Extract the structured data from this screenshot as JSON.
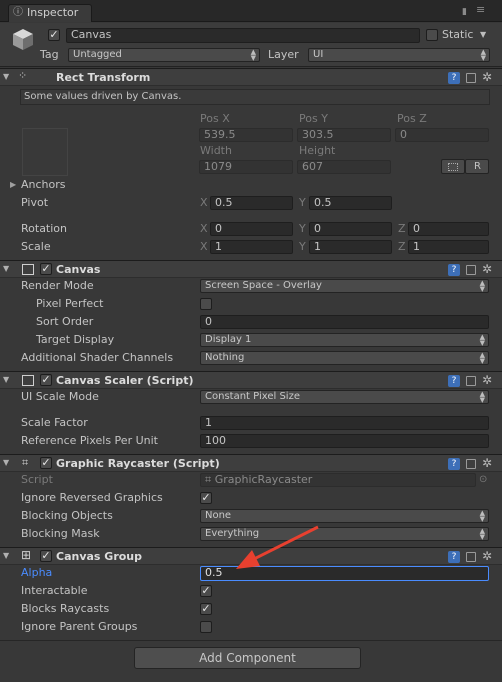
{
  "tab": {
    "title": "Inspector",
    "icon": "info-icon"
  },
  "header": {
    "object_name": "Canvas",
    "static_label": "Static",
    "tag_label": "Tag",
    "tag_value": "Untagged",
    "layer_label": "Layer",
    "layer_value": "UI"
  },
  "rect_transform": {
    "title": "Rect Transform",
    "note": "Some values driven by Canvas.",
    "pos_x_label": "Pos X",
    "pos_y_label": "Pos Y",
    "pos_z_label": "Pos Z",
    "pos_x": "539.5",
    "pos_y": "303.5",
    "pos_z": "0",
    "width_label": "Width",
    "height_label": "Height",
    "width": "1079",
    "height": "607",
    "r_button": "R",
    "anchors_label": "Anchors",
    "pivot_label": "Pivot",
    "pivot_x": "0.5",
    "pivot_y": "0.5",
    "rotation_label": "Rotation",
    "rot_x": "0",
    "rot_y": "0",
    "rot_z": "0",
    "scale_label": "Scale",
    "scale_x": "1",
    "scale_y": "1",
    "scale_z": "1",
    "x": "X",
    "y": "Y",
    "z": "Z"
  },
  "canvas": {
    "title": "Canvas",
    "render_mode_label": "Render Mode",
    "render_mode_value": "Screen Space - Overlay",
    "pixel_perfect_label": "Pixel Perfect",
    "sort_order_label": "Sort Order",
    "sort_order_value": "0",
    "target_display_label": "Target Display",
    "target_display_value": "Display 1",
    "shader_channels_label": "Additional Shader Channels",
    "shader_channels_value": "Nothing"
  },
  "canvas_scaler": {
    "title": "Canvas Scaler (Script)",
    "ui_scale_mode_label": "UI Scale Mode",
    "ui_scale_mode_value": "Constant Pixel Size",
    "scale_factor_label": "Scale Factor",
    "scale_factor_value": "1",
    "ref_ppu_label": "Reference Pixels Per Unit",
    "ref_ppu_value": "100"
  },
  "graphic_raycaster": {
    "title": "Graphic Raycaster (Script)",
    "script_label": "Script",
    "script_value": "GraphicRaycaster",
    "ignore_reversed_label": "Ignore Reversed Graphics",
    "blocking_objects_label": "Blocking Objects",
    "blocking_objects_value": "None",
    "blocking_mask_label": "Blocking Mask",
    "blocking_mask_value": "Everything"
  },
  "canvas_group": {
    "title": "Canvas Group",
    "alpha_label": "Alpha",
    "alpha_value": "0.5",
    "interactable_label": "Interactable",
    "blocks_raycasts_label": "Blocks Raycasts",
    "ignore_parent_label": "Ignore Parent Groups"
  },
  "add_component_label": "Add Component",
  "colors": {
    "panel_bg": "#383838",
    "header_bg": "#3e3e3e",
    "field_bg": "#2a2a2a",
    "highlight_blue": "#4a8cff",
    "annotation_red": "#e8402f",
    "help_icon_blue": "#3d6fb8"
  }
}
